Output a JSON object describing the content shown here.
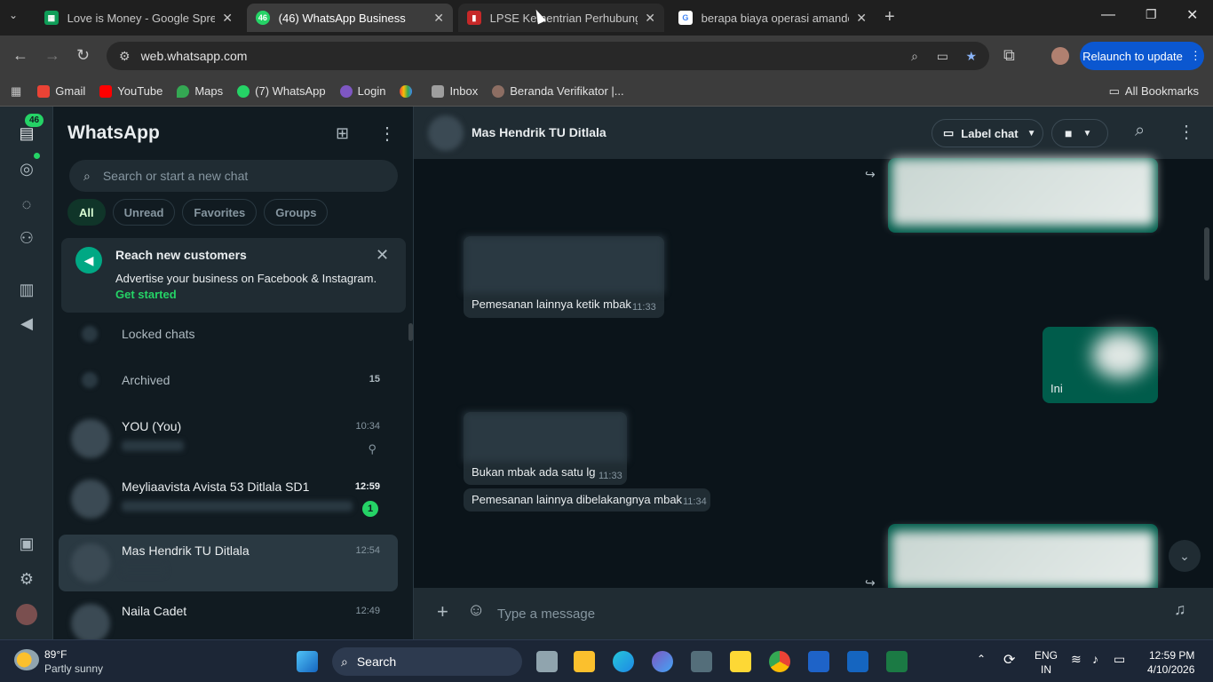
{
  "browser": {
    "tabs": [
      {
        "label": "Love is Money - Google Spread",
        "favicon": "sheets-icon",
        "color": "#0f9d58"
      },
      {
        "label": "(46) WhatsApp Business",
        "favicon": "46",
        "color": "#25d366"
      },
      {
        "label": "LPSE Kementrian Perhubungan",
        "favicon": "lpse-icon",
        "color": "#c62828"
      },
      {
        "label": "berapa biaya operasi amandel -",
        "favicon": "google-icon",
        "color": "#4285f4"
      }
    ],
    "url": "web.whatsapp.com",
    "relaunch_label": "Relaunch to update",
    "bookmarks": [
      "Gmail",
      "YouTube",
      "Maps",
      "(7) WhatsApp",
      "Login",
      "Inbox",
      "Beranda Verifikator |..."
    ],
    "all_bookmarks": "All Bookmarks"
  },
  "rail": {
    "badge": "46"
  },
  "sidebar": {
    "title": "WhatsApp",
    "search_placeholder": "Search or start a new chat",
    "chips": [
      "All",
      "Unread",
      "Favorites",
      "Groups"
    ],
    "promo": {
      "title": "Reach new customers",
      "body": "Advertise your business on Facebook & Instagram.",
      "cta": "Get started"
    },
    "locked": "Locked chats",
    "archived": "Archived",
    "archived_count": "15",
    "chats": [
      {
        "name": "YOU (You)",
        "time": "10:34",
        "unread": ""
      },
      {
        "name": "Meyliaavista Avista 53 Ditlala SD1",
        "time": "12:59",
        "unread": "1"
      },
      {
        "name": "Mas Hendrik TU Ditlala",
        "time": "12:54",
        "unread": ""
      },
      {
        "name": "Naila Cadet",
        "time": "12:49",
        "unread": ""
      }
    ]
  },
  "chat": {
    "contact": "Mas Hendrik TU Ditlala",
    "label_chat": "Label chat",
    "messages": [
      {
        "text": "Pemesanan lainnya ketik mbak",
        "time": "11:33"
      },
      {
        "text": "Ini",
        "time": ""
      },
      {
        "text": "Bukan mbak ada satu lg",
        "time": "11:33"
      },
      {
        "text": "Pemesanan lainnya dibelakangnya mbak",
        "time": "11:34"
      }
    ],
    "input_placeholder": "Type a message"
  },
  "taskbar": {
    "weather_temp": "89°F",
    "weather_desc": "Partly sunny",
    "search_label": "Search",
    "lang1": "ENG",
    "lang2": "IN",
    "time": "12:59 PM",
    "date": "4/10/2026"
  }
}
